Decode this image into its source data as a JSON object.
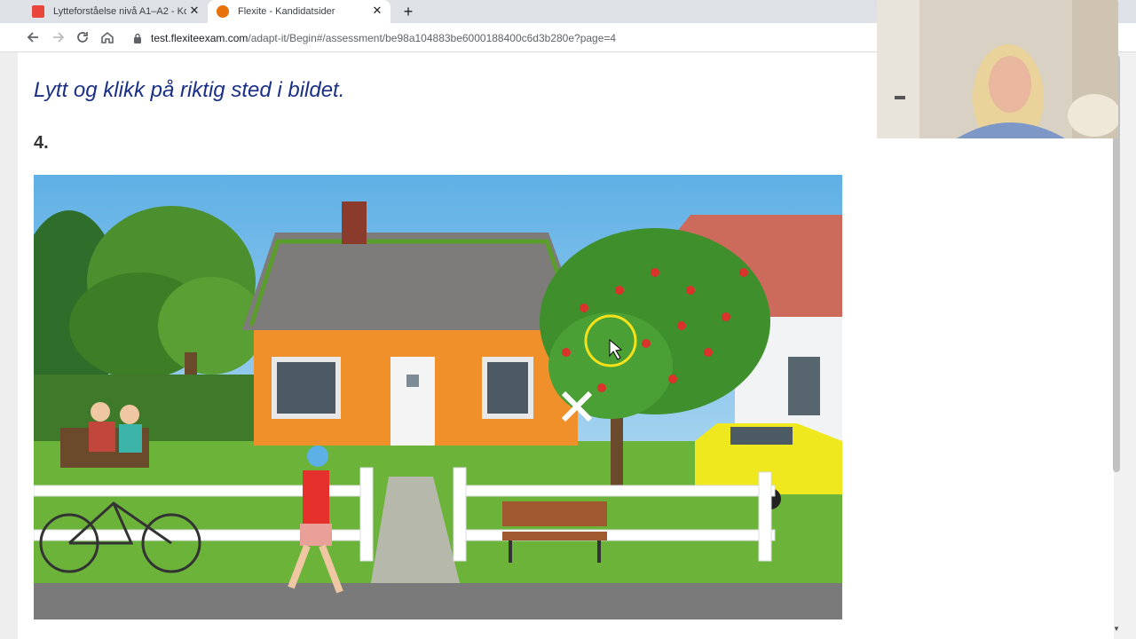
{
  "browser": {
    "tabs": [
      {
        "title": "Lytteforståelse nivå A1–A2 - Kom",
        "close": "✕",
        "favicon_color": "#e8453c"
      },
      {
        "title": "Flexite - Kandidatsider",
        "close": "✕",
        "favicon_color": "#e8710a"
      }
    ],
    "new_tab": "+",
    "url_host": "test.flexiteexam.com",
    "url_path": "/adapt-it/Begin#/assessment/be98a104883be6000188400c6d3b280e?page=4"
  },
  "page": {
    "instruction": "Lytt og klikk på riktig sted i bildet.",
    "question_number": "4."
  },
  "scene": {
    "description_icons": [
      "tree-icon",
      "house-icon",
      "bench-icon",
      "bicycle-icon",
      "car-icon"
    ],
    "marker_icon": "x-marker-icon",
    "cursor_icon": "mouse-pointer-icon"
  },
  "colors": {
    "instruction_text": "#1a2f86",
    "house_orange": "#f0902a",
    "sky": "#8cc6ea",
    "grass": "#6cb33a",
    "highlight_ring": "#f4e11a"
  }
}
